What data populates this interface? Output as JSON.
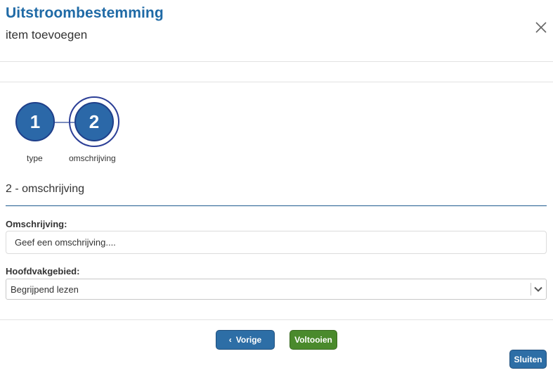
{
  "header": {
    "title": "Uitstroombestemming",
    "subtitle": "item toevoegen",
    "close_icon": "close-icon"
  },
  "stepper": {
    "steps": [
      {
        "number": "1",
        "label": "type",
        "active": false
      },
      {
        "number": "2",
        "label": "omschrijving",
        "active": true
      }
    ]
  },
  "section": {
    "title": "2 - omschrijving"
  },
  "form": {
    "omschrijving_label": "Omschrijving:",
    "omschrijving_placeholder": "Geef een omschrijving....",
    "hoofdvak_label": "Hoofdvakgebied:",
    "hoofdvak_value": "Begrijpend lezen"
  },
  "buttons": {
    "prev_label": "Vorige",
    "finish_label": "Voltooien",
    "close_label": "Sluiten"
  },
  "colors": {
    "title": "#1f6aa6",
    "primary": "#2d6ea6",
    "success": "#4a8a2c"
  }
}
